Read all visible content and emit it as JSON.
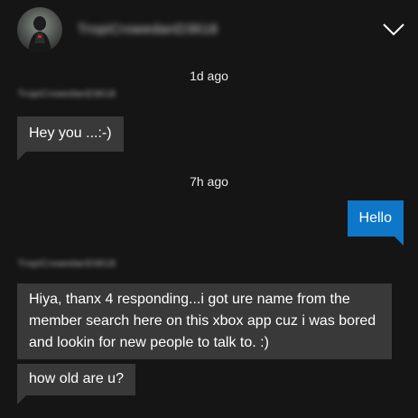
{
  "header": {
    "username": "TropiCrowedanD3618",
    "avatar_icon": "profile-avatar",
    "collapse_icon": "chevron-down-icon"
  },
  "messages": [
    {
      "type": "timestamp",
      "text": "1d ago"
    },
    {
      "type": "sender",
      "text": "TropiCrowedanD3618"
    },
    {
      "type": "incoming",
      "text": "Hey you ...:-)"
    },
    {
      "type": "timestamp",
      "text": "7h ago"
    },
    {
      "type": "outgoing",
      "text": "Hello"
    },
    {
      "type": "sender",
      "text": "TropiCrowedanD3618"
    },
    {
      "type": "incoming",
      "text": "Hiya, thanx 4 responding...i got ure name from the member search here on this xbox app cuz i was bored and lookin for new people to talk to. :)"
    },
    {
      "type": "incoming",
      "text": "how old are u?"
    }
  ],
  "colors": {
    "background": "#151515",
    "incoming_bubble": "#393939",
    "outgoing_bubble": "#0f77c7",
    "text": "#ffffff"
  }
}
